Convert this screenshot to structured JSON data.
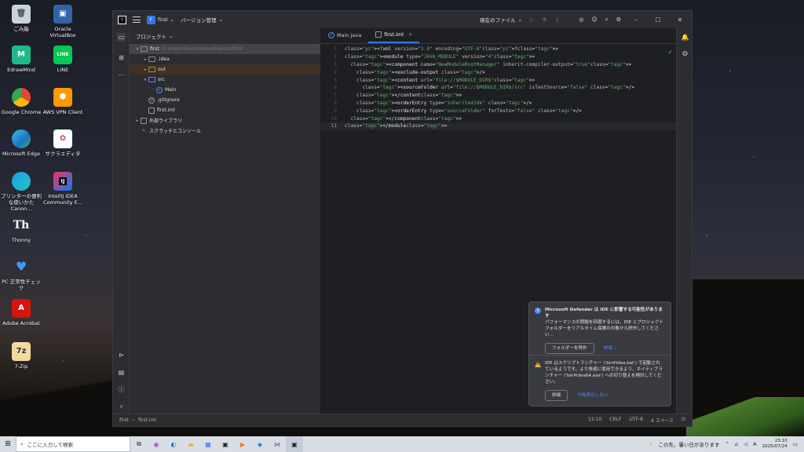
{
  "desktop": {
    "icons": [
      {
        "label": "ごみ箱"
      },
      {
        "label": "Oracle VirtualBox"
      },
      {
        "label": "EdrawMind"
      },
      {
        "label": "LINE"
      },
      {
        "label": "Google Chrome"
      },
      {
        "label": "AWS VPN Client"
      },
      {
        "label": "Microsoft Edge"
      },
      {
        "label": "サクラエディタ"
      },
      {
        "label": "プリンターの便利な使いかた Canon..."
      },
      {
        "label": "IntelliJ IDEA Community E..."
      },
      {
        "label": "Thonny"
      },
      {
        "label": "PC 正常性チェック"
      },
      {
        "label": "Adobe Acrobat"
      },
      {
        "label": "7-Zip"
      }
    ]
  },
  "ide": {
    "titlebar": {
      "logo": "IJ",
      "project_badge": "F",
      "project_name": "first",
      "vcs_menu": "バージョン管理",
      "run_config": "現在のファイル"
    },
    "project_panel": {
      "title": "プロジェクト",
      "tree": [
        {
          "label": "first",
          "path": "C:¥Users¥kucin¥IdeaProjects¥first"
        },
        {
          "label": ".idea"
        },
        {
          "label": "out"
        },
        {
          "label": "src"
        },
        {
          "label": "Main"
        },
        {
          "label": ".gitignore"
        },
        {
          "label": "first.iml"
        },
        {
          "label": "外部ライブラリ"
        },
        {
          "label": "スクラッチとコンソール"
        }
      ]
    },
    "editor": {
      "tabs": [
        {
          "label": "Main.java"
        },
        {
          "label": "first.iml"
        }
      ],
      "line_numbers": [
        "1",
        "2",
        "3",
        "4",
        "5",
        "6",
        "7",
        "8",
        "9",
        "10",
        "11"
      ],
      "code_lines": [
        "<?xml version=\"1.0\" encoding=\"UTF-8\"?>",
        "<module type=\"JAVA_MODULE\" version=\"4\">",
        "  <component name=\"NewModuleRootManager\" inherit-compiler-output=\"true\">",
        "    <exclude-output />",
        "    <content url=\"file://$MODULE_DIR$\">",
        "      <sourceFolder url=\"file://$MODULE_DIR$/src\" isTestSource=\"false\" />",
        "    </content>",
        "    <orderEntry type=\"inheritedJdk\" />",
        "    <orderEntry type=\"sourceFolder\" forTests=\"false\" />",
        "  </component>",
        "</module>"
      ]
    },
    "status_bar": {
      "breadcrumb_project": "first",
      "breadcrumb_file": "first.iml",
      "position": "11:10",
      "line_sep": "CRLF",
      "encoding": "UTF-8",
      "indent": "4 スペース"
    },
    "notifications": [
      {
        "title": "Microsoft Defender は IDE に影響する可能性があります",
        "body": "パフォーマンスの問題を回避するには、IDE とプロジェクトフォルダーをリアルタイム保護の対象から除外してください...",
        "button": "フォルダーを除外",
        "link": "詳細"
      },
      {
        "title": "IDE はスクリプトランチャー ('bin¥idea.bat') で起動されているようです。より快適に使用できるよう、ネイティブランチャー ('bin¥idea64.exe') への切り替えを検討してください。",
        "button": "詳細",
        "link": "今後表示しない"
      }
    ]
  },
  "taskbar": {
    "search_placeholder": "ここに入力して検索",
    "weather": "この先、暑い日があります",
    "time": "23:10",
    "date": "2025/07/24"
  }
}
